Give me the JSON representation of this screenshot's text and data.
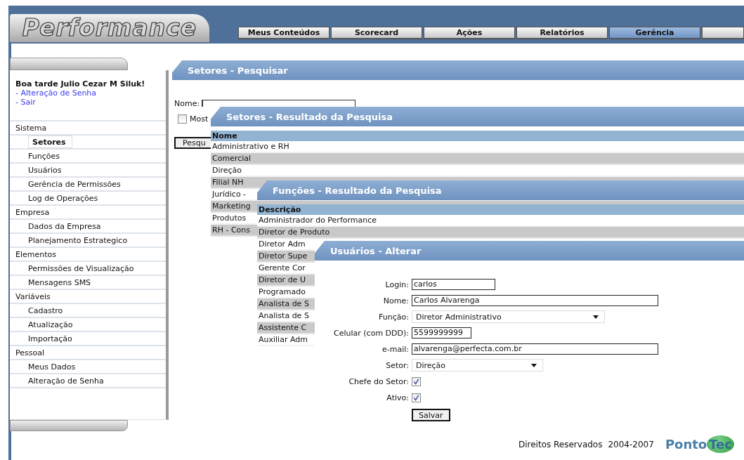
{
  "app": {
    "logo": "Performance"
  },
  "tabs": [
    {
      "label": "Meus Conteúdos",
      "selected": false
    },
    {
      "label": "Scorecard",
      "selected": false
    },
    {
      "label": "Ações",
      "selected": false
    },
    {
      "label": "Relatórios",
      "selected": false
    },
    {
      "label": "Gerência",
      "selected": true
    }
  ],
  "sidebar": {
    "greeting": "Boa tarde Julio Cezar M Siluk!",
    "links": [
      "- Alteração de Senha",
      "- Sair"
    ],
    "groups": [
      {
        "label": "Sistema",
        "children": [
          {
            "label": "Setores",
            "selected": true
          },
          {
            "label": "Funções",
            "selected": false
          },
          {
            "label": "Usuários",
            "selected": false
          },
          {
            "label": "Gerência de Permissões",
            "selected": false
          },
          {
            "label": "Log de Operações",
            "selected": false
          }
        ]
      },
      {
        "label": "Empresa",
        "children": [
          {
            "label": "Dados da Empresa",
            "selected": false
          },
          {
            "label": "Planejamento Estrategico",
            "selected": false
          }
        ]
      },
      {
        "label": "Elementos",
        "children": [
          {
            "label": "Permissões de Visualização",
            "selected": false
          },
          {
            "label": "Mensagens SMS",
            "selected": false
          }
        ]
      },
      {
        "label": "Variáveis",
        "children": [
          {
            "label": "Cadastro",
            "selected": false
          },
          {
            "label": "Atualização",
            "selected": false
          },
          {
            "label": "Importação",
            "selected": false
          }
        ]
      },
      {
        "label": "Pessoal",
        "children": [
          {
            "label": "Meus Dados",
            "selected": false
          },
          {
            "label": "Alteração de Senha",
            "selected": false
          }
        ]
      }
    ]
  },
  "search_panel": {
    "title": "Setores - Pesquisar",
    "name_label": "Nome:",
    "show_checkbox": {
      "label": "Most",
      "checked": false
    },
    "button": "Pesqu"
  },
  "setores_results": {
    "title": "Setores - Resultado da Pesquisa",
    "column": "Nome",
    "rows": [
      "Administrativo e RH",
      "Comercial",
      "Direção",
      "Filial NH",
      "Jurídico -",
      "Marketing",
      "Produtos",
      "RH - Cons"
    ]
  },
  "funcoes_results": {
    "title": "Funções - Resultado da Pesquisa",
    "column": "Descrição",
    "rows": [
      "Administrador do Performance",
      "Diretor de Produto",
      "Diretor Adm",
      "Diretor Supe",
      "Gerente Cor",
      "Diretor de U",
      "Programado",
      "Analista de S",
      "Analista de S",
      "Assistente C",
      "Auxiliar Adm"
    ]
  },
  "user_form": {
    "title": "Usuários - Alterar",
    "fields": [
      {
        "label": "Login:",
        "kind": "text",
        "value": "carlos"
      },
      {
        "label": "Nome:",
        "kind": "text",
        "value": "Carlos Alvarenga"
      },
      {
        "label": "Função:",
        "kind": "select",
        "value": "Diretor Administrativo"
      },
      {
        "label": "Celular (com DDD):",
        "kind": "text",
        "value": "5599999999"
      },
      {
        "label": "e-mail:",
        "kind": "text",
        "value": "alvarenga@perfecta.com.br"
      },
      {
        "label": "Setor:",
        "kind": "select",
        "value": "Direção"
      },
      {
        "label": "Chefe do Setor:",
        "kind": "checkbox",
        "checked": true
      },
      {
        "label": "Ativo:",
        "kind": "checkbox",
        "checked": true
      }
    ],
    "button": "Salvar"
  },
  "footer": {
    "copyright": "Direitos Reservados",
    "years": "2004-2007",
    "brand": {
      "text": "Ponto",
      "accent": "Tec"
    }
  }
}
